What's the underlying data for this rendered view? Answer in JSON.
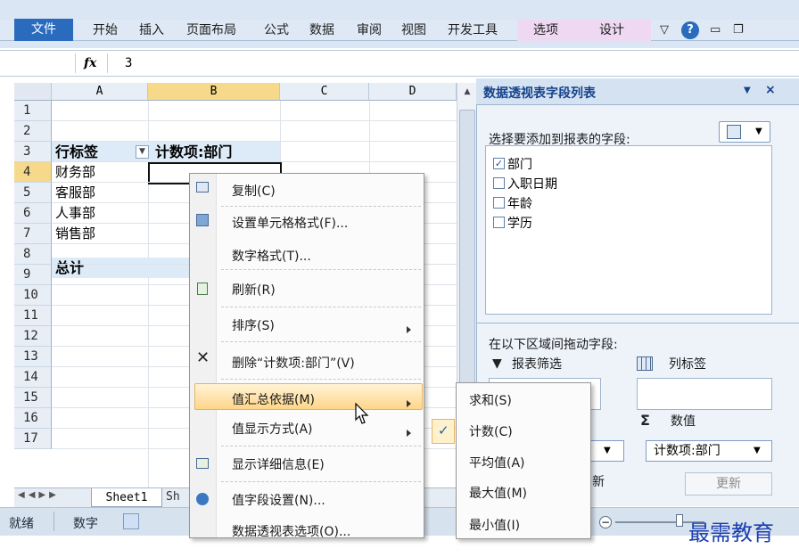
{
  "ribbon": {
    "tabs": [
      "文件",
      "开始",
      "插入",
      "页面布局",
      "公式",
      "数据",
      "审阅",
      "视图",
      "开发工具",
      "选项",
      "设计"
    ]
  },
  "formula_bar": {
    "fx": "fx",
    "value": "3"
  },
  "grid": {
    "columns": [
      "A",
      "B",
      "C",
      "D"
    ],
    "rows": [
      "1",
      "2",
      "3",
      "4",
      "5",
      "6",
      "7",
      "8",
      "9",
      "10",
      "11",
      "12",
      "13",
      "14",
      "15",
      "16",
      "17"
    ],
    "pivot": {
      "row_label_header": "行标签",
      "value_header": "计数项:部门",
      "items": [
        "财务部",
        "客服部",
        "人事部",
        "销售部"
      ],
      "total": "总计"
    }
  },
  "sheet_tabs": {
    "sheet1": "Sheet1",
    "sheet2": "Sh"
  },
  "status": {
    "ready": "就绪",
    "mode": "数字"
  },
  "pane": {
    "title": "数据透视表字段列表",
    "choose_label": "选择要添加到报表的字段:",
    "fields": [
      {
        "label": "部门",
        "checked": true
      },
      {
        "label": "入职日期",
        "checked": false
      },
      {
        "label": "年龄",
        "checked": false
      },
      {
        "label": "学历",
        "checked": false
      }
    ],
    "drag_label": "在以下区域间拖动字段:",
    "report_filter": "报表筛选",
    "col_labels": "列标签",
    "values_header": "数值",
    "values_item": "计数项:部门",
    "partial_text": "新",
    "update_button": "更新"
  },
  "context_menu": {
    "items": [
      {
        "label": "复制(C)"
      },
      {
        "label": "设置单元格格式(F)..."
      },
      {
        "label": "数字格式(T)..."
      },
      {
        "label": "刷新(R)"
      },
      {
        "label": "排序(S)"
      },
      {
        "label": "删除“计数项:部门”(V)"
      },
      {
        "label": "值汇总依据(M)"
      },
      {
        "label": "值显示方式(A)"
      },
      {
        "label": "显示详细信息(E)"
      },
      {
        "label": "值字段设置(N)..."
      },
      {
        "label": "数据透视表选项(O)..."
      }
    ]
  },
  "sub_menu": {
    "items": [
      "求和(S)",
      "计数(C)",
      "平均值(A)",
      "最大值(M)",
      "最小值(I)"
    ]
  },
  "watermark": "最需教育",
  "colors": {
    "file_tab": "#2a6bbd",
    "hover": "#ffd58a",
    "pane_bg": "#eef3fa",
    "watermark": "#1c3fb0"
  }
}
